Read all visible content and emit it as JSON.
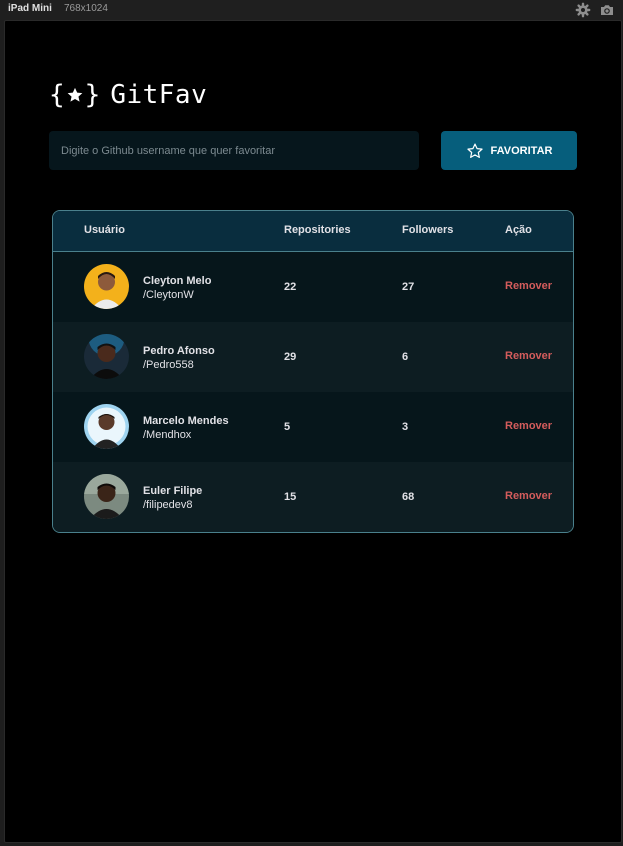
{
  "device": {
    "name": "iPad Mini",
    "size": "768x1024"
  },
  "toolbar_icons": [
    "gear-icon",
    "camera-icon"
  ],
  "logo": {
    "text": "GitFav",
    "icon": "star-icon"
  },
  "search": {
    "placeholder": "Digite o Github username que quer favoritar",
    "value": ""
  },
  "favorite_button": {
    "label": "FAVORITAR",
    "icon": "star-outline-icon"
  },
  "table": {
    "headers": {
      "user": "Usuário",
      "repositories": "Repositories",
      "followers": "Followers",
      "action": "Ação"
    },
    "rows": [
      {
        "name": "Cleyton Melo",
        "login": "/CleytonW",
        "repositories": "22",
        "followers": "27",
        "action": "Remover",
        "avatar_bg": "#f3b11b",
        "avatar_skin": "#8d5a3b"
      },
      {
        "name": "Pedro Afonso",
        "login": "/Pedro558",
        "repositories": "29",
        "followers": "6",
        "action": "Remover",
        "avatar_bg": "#1a2a38",
        "avatar_skin": "#4a2a1c"
      },
      {
        "name": "Marcelo Mendes",
        "login": "/Mendhox",
        "repositories": "5",
        "followers": "3",
        "action": "Remover",
        "avatar_bg": "#9fd4f0",
        "avatar_skin": "#5a3a2a"
      },
      {
        "name": "Euler Filipe",
        "login": "/filipedev8",
        "repositories": "15",
        "followers": "68",
        "action": "Remover",
        "avatar_bg": "#7c8a80",
        "avatar_skin": "#3a2418"
      }
    ]
  },
  "colors": {
    "background": "#000000",
    "button": "#065e7c",
    "table_header": "#092d3e",
    "remove_text": "#d45c5c",
    "border": "#4a808c"
  }
}
